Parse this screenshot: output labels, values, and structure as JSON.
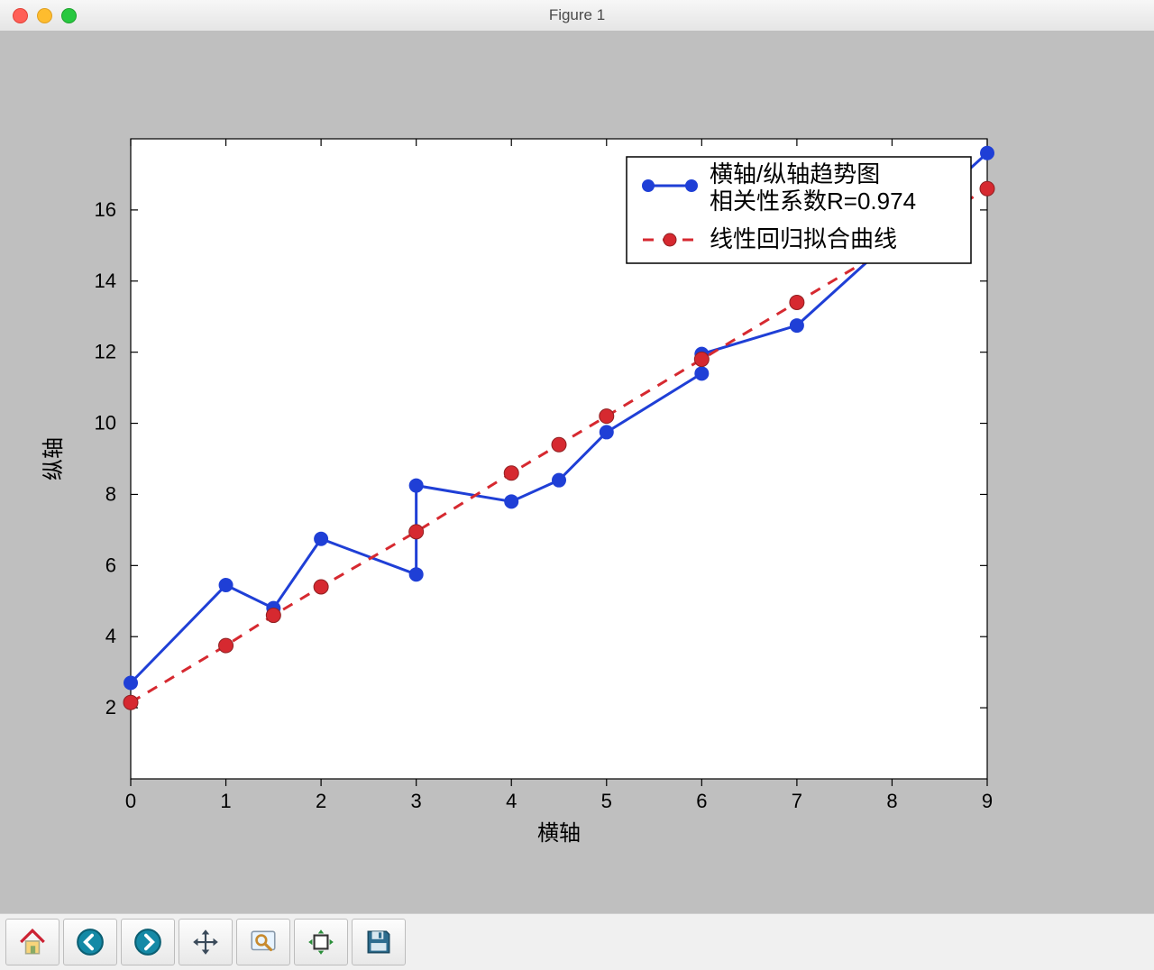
{
  "window": {
    "title": "Figure 1"
  },
  "toolbar": {
    "home": "home-icon",
    "back": "back-icon",
    "forward": "forward-icon",
    "pan": "pan-icon",
    "zoom": "zoom-icon",
    "subplot": "subplot-icon",
    "save": "save-icon"
  },
  "chart_data": {
    "type": "line",
    "xlabel": "横轴",
    "ylabel": "纵轴",
    "xlim": [
      0,
      9
    ],
    "ylim": [
      0,
      18
    ],
    "xticks": [
      0,
      1,
      2,
      3,
      4,
      5,
      6,
      7,
      8,
      9
    ],
    "yticks": [
      2,
      4,
      6,
      8,
      10,
      12,
      14,
      16
    ],
    "series": [
      {
        "name_line1": "横轴/纵轴趋势图",
        "name_line2": "相关性系数R=0.974",
        "style": "blue-solid",
        "x": [
          0,
          1,
          1.5,
          2,
          3,
          3,
          4,
          4.5,
          5,
          6,
          6,
          7,
          9
        ],
        "values": [
          2.7,
          5.45,
          4.8,
          6.75,
          5.75,
          8.25,
          7.8,
          8.4,
          9.75,
          11.4,
          11.95,
          12.75,
          17.6
        ]
      },
      {
        "name_line1": "线性回归拟合曲线",
        "style": "red-dashed",
        "x": [
          0,
          1,
          1.5,
          2,
          3,
          4,
          4.5,
          5,
          6,
          7,
          9
        ],
        "values": [
          2.15,
          3.75,
          4.6,
          5.4,
          6.95,
          8.6,
          9.4,
          10.2,
          11.8,
          13.4,
          16.6
        ]
      }
    ],
    "legend": {
      "items": [
        {
          "series": 0
        },
        {
          "series": 1
        }
      ]
    }
  }
}
